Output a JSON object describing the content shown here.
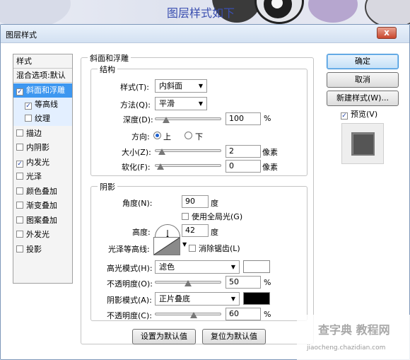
{
  "banner": {
    "title": "图层样式如下"
  },
  "window": {
    "title": "图层样式",
    "close": "x"
  },
  "style_list": {
    "header": "样式",
    "items": [
      {
        "label": "混合选项:默认",
        "checkbox": false,
        "checked": false
      },
      {
        "label": "斜面和浮雕",
        "checkbox": true,
        "checked": true
      },
      {
        "label": "等高线",
        "checkbox": true,
        "checked": true
      },
      {
        "label": "纹理",
        "checkbox": true,
        "checked": false
      },
      {
        "label": "描边",
        "checkbox": true,
        "checked": false
      },
      {
        "label": "内阴影",
        "checkbox": true,
        "checked": false
      },
      {
        "label": "内发光",
        "checkbox": true,
        "checked": true
      },
      {
        "label": "光泽",
        "checkbox": true,
        "checked": false
      },
      {
        "label": "颜色叠加",
        "checkbox": true,
        "checked": false
      },
      {
        "label": "渐变叠加",
        "checkbox": true,
        "checked": false
      },
      {
        "label": "图案叠加",
        "checkbox": true,
        "checked": false
      },
      {
        "label": "外发光",
        "checkbox": true,
        "checked": false
      },
      {
        "label": "投影",
        "checkbox": true,
        "checked": false
      }
    ]
  },
  "bevel": {
    "title": "斜面和浮雕",
    "structure": {
      "title": "结构",
      "style_label": "样式(T):",
      "style_value": "内斜面",
      "technique_label": "方法(Q):",
      "technique_value": "平滑",
      "depth_label": "深度(D):",
      "depth_value": "100",
      "depth_unit": "%",
      "depth_level": 0.1,
      "direction_label": "方向:",
      "direction_up": "上",
      "direction_down": "下",
      "direction_selected": "上",
      "size_label": "大小(Z):",
      "size_value": "2",
      "size_unit": "像素",
      "size_level": 0.02,
      "soften_label": "软化(F):",
      "soften_value": "0",
      "soften_unit": "像素",
      "soften_level": 0.0
    },
    "shading": {
      "title": "阴影",
      "angle_label": "角度(N):",
      "angle_value": "90",
      "angle_unit": "度",
      "global_light_label": "使用全局光(G)",
      "global_light_checked": false,
      "altitude_label": "高度:",
      "altitude_value": "42",
      "altitude_unit": "度",
      "gloss_label": "光泽等高线:",
      "antialias_label": "消除锯齿(L)",
      "antialias_checked": false,
      "highlight_mode_label": "高光模式(H):",
      "highlight_mode_value": "滤色",
      "highlight_color": "#ffffff",
      "highlight_opacity_label": "不透明度(O):",
      "highlight_opacity_value": "50",
      "highlight_opacity_unit": "%",
      "highlight_opacity_level": 0.5,
      "shadow_mode_label": "阴影模式(A):",
      "shadow_mode_value": "正片叠底",
      "shadow_color": "#000000",
      "shadow_opacity_label": "不透明度(C):",
      "shadow_opacity_value": "60",
      "shadow_opacity_unit": "%",
      "shadow_opacity_level": 0.6
    },
    "make_default": "设置为默认值",
    "reset_default": "复位为默认值"
  },
  "actions": {
    "ok": "确定",
    "cancel": "取消",
    "new_style": "新建样式(W)...",
    "preview_label": "预览(V)",
    "preview_checked": true
  },
  "watermark": {
    "text": "查字典 教程网",
    "url": "jiaocheng.chazidian.com"
  }
}
